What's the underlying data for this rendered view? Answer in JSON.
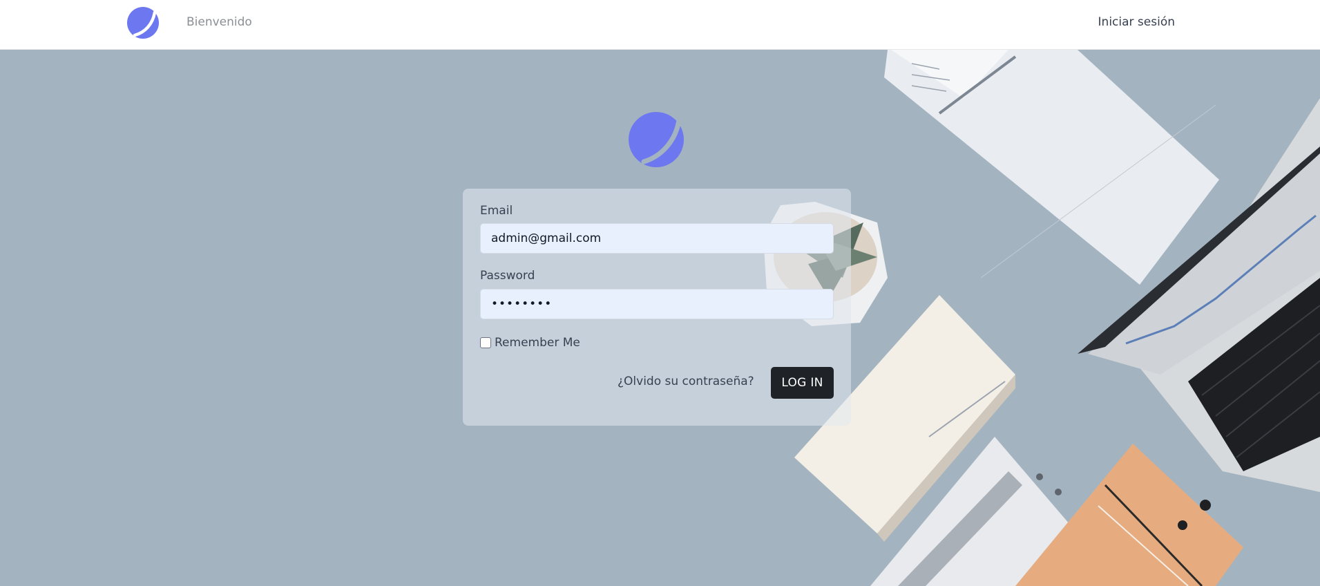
{
  "navbar": {
    "logo_icon": "planet-logo-icon",
    "welcome_link": "Bienvenido",
    "login_link": "Iniciar sesión"
  },
  "hero": {
    "logo_icon": "planet-logo-icon",
    "brand_color": "#6d78f0",
    "background_color": "#a3b4c0"
  },
  "login_form": {
    "email_label": "Email",
    "email_value": "admin@gmail.com",
    "password_label": "Password",
    "password_value": "••••••••",
    "remember_label": "Remember Me",
    "remember_checked": false,
    "forgot_link": "¿Olvido su contraseña?",
    "submit_label": "LOG IN"
  }
}
